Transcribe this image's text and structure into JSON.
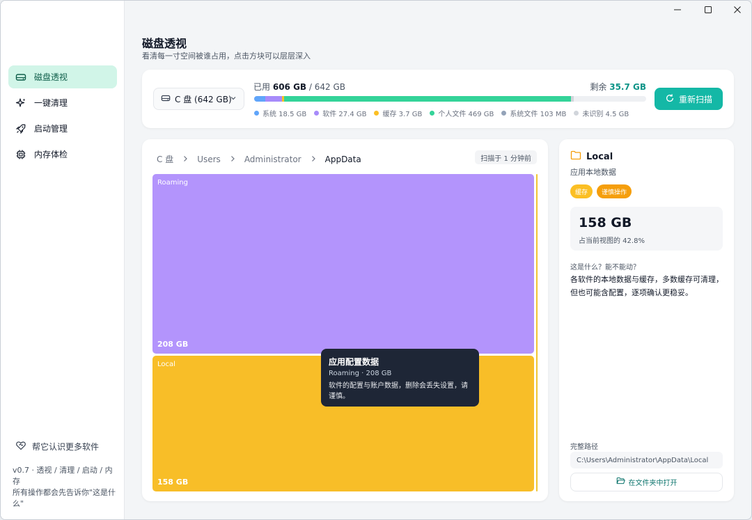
{
  "window": {
    "controls": {
      "minimize": "—",
      "maximize": "☐",
      "close": "✕"
    }
  },
  "sidebar": {
    "items": [
      {
        "label": "磁盘透视",
        "icon": "drive-icon",
        "active": true
      },
      {
        "label": "一键清理",
        "icon": "sparkle-icon",
        "active": false
      },
      {
        "label": "启动管理",
        "icon": "rocket-icon",
        "active": false
      },
      {
        "label": "内存体检",
        "icon": "chip-icon",
        "active": false
      }
    ],
    "learn_more": "帮它认识更多软件",
    "version_line1": "v0.7 · 透视 / 清理 / 启动 / 内存",
    "version_line2": "所有操作都会先告诉你\"这是什",
    "version_line3": "么\""
  },
  "header": {
    "title": "磁盘透视",
    "subtitle": "看清每一寸空间被谁占用，点击方块可以层层深入"
  },
  "summary": {
    "drive_label": "C 盘 (642 GB)",
    "used_prefix": "已用",
    "used_value": "606 GB",
    "used_total": "/ 642 GB",
    "remain_prefix": "剩余",
    "remain_value": "35.7 GB",
    "rescan_label": "重新扫描",
    "segments": [
      {
        "name": "系统",
        "label": "系统 18.5 GB",
        "gb": 18.5,
        "color": "#60a5fa"
      },
      {
        "name": "软件",
        "label": "软件 27.4 GB",
        "gb": 27.4,
        "color": "#a78bfa"
      },
      {
        "name": "缓存",
        "label": "缓存 3.7 GB",
        "gb": 3.7,
        "color": "#fbbf24"
      },
      {
        "name": "个人文件",
        "label": "个人文件 469 GB",
        "gb": 469,
        "color": "#34d399"
      },
      {
        "name": "系统文件",
        "label": "系统文件 103 MB",
        "gb": 0.1,
        "color": "#94a3b8"
      },
      {
        "name": "未识别",
        "label": "未识别 4.5 GB",
        "gb": 4.5,
        "color": "#d1d5db"
      }
    ],
    "total_gb": 642
  },
  "treemap": {
    "breadcrumb": [
      "C 盘",
      "Users",
      "Administrator",
      "AppData"
    ],
    "scan_time": "扫描于 1 分钟前",
    "tiles": [
      {
        "name": "Roaming",
        "size": "208 GB",
        "color": "#b394fc"
      },
      {
        "name": "Local",
        "size": "158 GB",
        "color": "#f8be28"
      }
    ],
    "tooltip": {
      "title": "应用配置数据",
      "meta": "Roaming · 208 GB",
      "desc": "软件的配置与账户数据，删除会丢失设置，请谨慎。"
    }
  },
  "detail": {
    "title": "Local",
    "subtitle": "应用本地数据",
    "tags": [
      "缓存",
      "谨慎操作"
    ],
    "size": "158 GB",
    "percent": "占当前视图的 42.8%",
    "question": "这是什么？能不能动？",
    "answer": "各软件的本地数据与缓存，多数缓存可清理，但也可能含配置，逐项确认更稳妥。",
    "path_label": "完整路径",
    "path": "C:\\Users\\Administrator\\AppData\\Local",
    "open_label": "在文件夹中打开"
  }
}
